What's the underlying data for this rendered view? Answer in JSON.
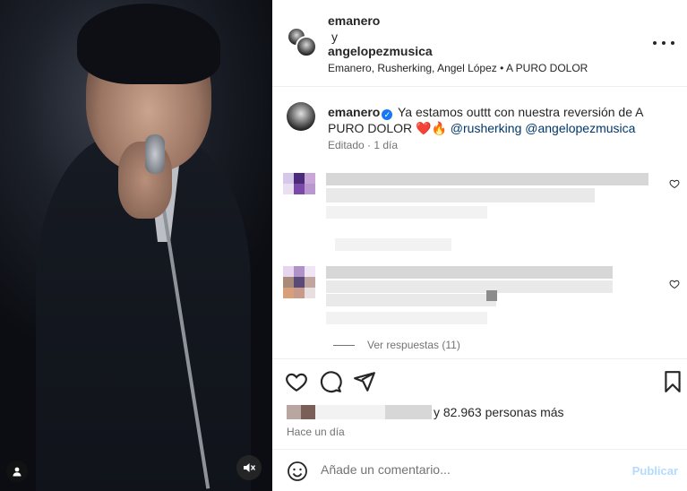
{
  "header": {
    "user1": "emanero",
    "connector": "y",
    "user2": "angelopezmusica",
    "subtitle": "Emanero, Rusherking, Angel López • A PURO DOLOR"
  },
  "caption": {
    "username": "emanero",
    "text": "Ya estamos outtt con nuestra reversión de A PURO DOLOR",
    "emoji": "❤️🔥",
    "mention1": "@rusherking",
    "mention2": "@angelopezmusica",
    "edited": "Editado",
    "time": "1 día"
  },
  "comments": {
    "view_replies": "Ver respuestas (11)"
  },
  "likes": {
    "count_text": "y 82.963 personas más",
    "time": "Hace un día"
  },
  "add_comment": {
    "placeholder": "Añade un comentario...",
    "publish": "Publicar"
  },
  "icons": {
    "more": "more-options-icon",
    "like": "heart-icon",
    "comment": "comment-icon",
    "share": "share-icon",
    "save": "bookmark-icon",
    "emoji": "emoji-icon",
    "mute": "muted-speaker-icon",
    "tag": "user-tag-icon"
  },
  "colors": {
    "verified": "#1877f2",
    "heart": "#ed4956",
    "link": "#00376b",
    "publish_disabled": "#b3dbff"
  }
}
